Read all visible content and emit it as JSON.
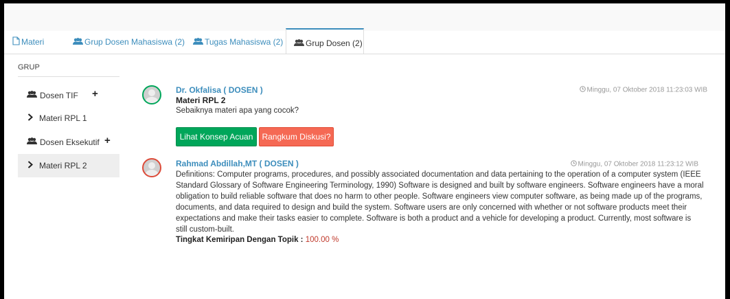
{
  "tabs": [
    {
      "label": "Materi",
      "icon": "file-icon"
    },
    {
      "label": "Grup Dosen Mahasiswa (2)",
      "icon": "group-icon"
    },
    {
      "label": "Tugas Mahasiswa (2)",
      "icon": "group-icon"
    },
    {
      "label": "Grup Dosen (2)",
      "icon": "group-icon",
      "active": true
    }
  ],
  "sidebar": {
    "header": "GRUP",
    "items": [
      {
        "label": "Dosen TIF",
        "icon": "group-icon",
        "action": "plus-icon"
      },
      {
        "label": "Materi RPL 1",
        "icon": "chevron-right-icon"
      },
      {
        "label": "Dosen Eksekutif",
        "icon": "group-icon",
        "action": "plus-icon"
      },
      {
        "label": "Materi RPL 2",
        "icon": "chevron-right-icon",
        "selected": true
      }
    ]
  },
  "posts": [
    {
      "author": "Dr. Okfalisa ( DOSEN )",
      "topic": "Materi RPL 2",
      "text": "Sebaiknya materi apa yang cocok?",
      "timestamp": "Minggu, 07 Oktober 2018 11:23:03 WIB",
      "buttons": {
        "primary": "Lihat Konsep Acuan",
        "secondary": "Rangkum Diskusi?"
      }
    },
    {
      "author": "Rahmad Abdillah,MT ( DOSEN )",
      "timestamp": "Minggu, 07 Oktober 2018 11:23:12 WIB",
      "text": "Definitions: Computer programs, procedures, and possibly associated documentation and data pertaining to the operation of a computer system (IEEE Standard Glossary of Software Engineering Terminology, 1990) Software is designed and built by software engineers. Software engineers have a moral obligation to build reliable software that does no harm to other people. Software engineers view computer software, as being made up of the programs, documents, and data required to design and build the system. Software users are only concerned with whether or not software products meet their expectations and make their tasks easier to complete. Software is both a product and a vehicle for developing a product. Currently, most software is still custom-built.",
      "similarity_label": "Tingkat Kemiripan Dengan Topik :",
      "similarity_value": "100.00 %"
    }
  ],
  "colors": {
    "accent": "#3c8dbc",
    "success": "#00a65a",
    "danger": "#f56954",
    "similarity": "#c0392b"
  }
}
